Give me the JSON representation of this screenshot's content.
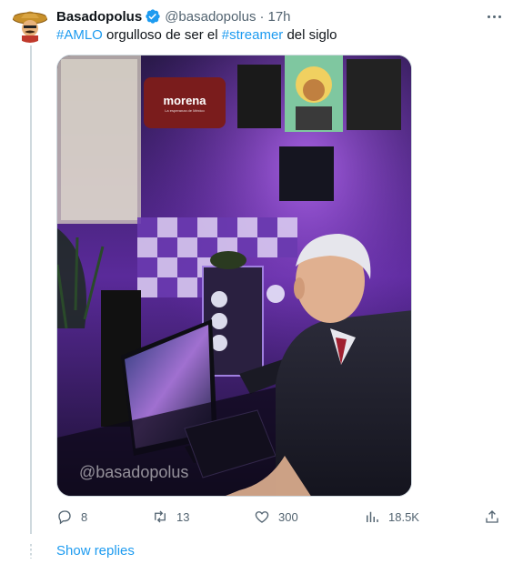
{
  "tweet": {
    "display_name": "Basadopolus",
    "handle": "@basadopolus",
    "separator": "·",
    "time": "17h",
    "text_parts": {
      "hashtag1": "#AMLO",
      "middle": " orgulloso de ser el ",
      "hashtag2": "#streamer",
      "end": " del siglo"
    },
    "media": {
      "watermark": "@basadopolus",
      "logo_name": "morena",
      "logo_sub": "La esperanza de México"
    },
    "actions": {
      "replies": "8",
      "retweets": "13",
      "likes": "300",
      "views": "18.5K"
    },
    "show_replies_label": "Show replies"
  },
  "icons": {
    "avatar": "mariachi-sombrero-avatar",
    "verified": "verified-badge-icon",
    "more": "more-icon",
    "reply": "reply-icon",
    "retweet": "retweet-icon",
    "like": "heart-icon",
    "views": "views-icon",
    "share": "share-icon"
  },
  "colors": {
    "accent": "#1d9bf0",
    "secondary_text": "#536471",
    "primary_text": "#0f1419"
  }
}
